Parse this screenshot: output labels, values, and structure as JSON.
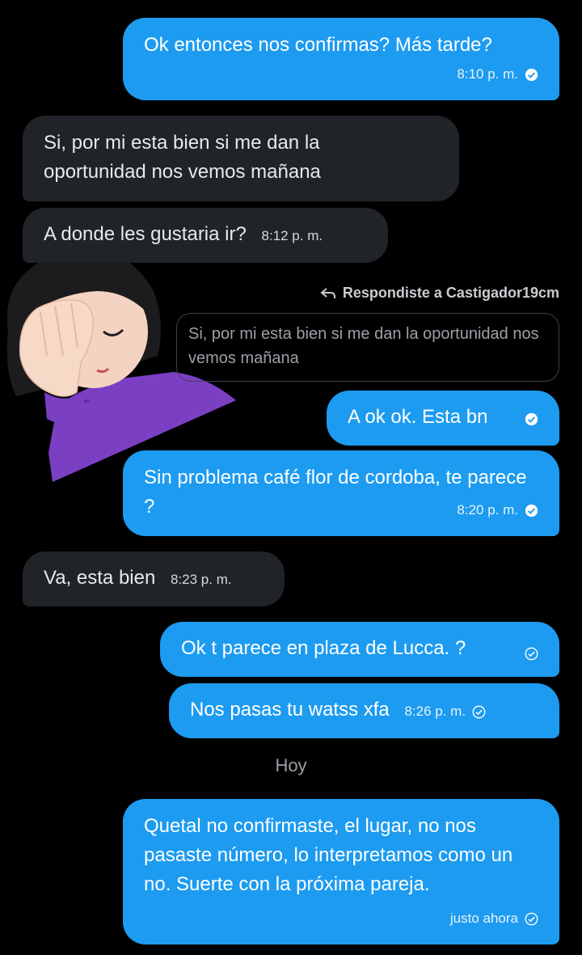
{
  "messages": [
    {
      "id": "m1",
      "text": "Ok entonces nos confirmas? Más tarde?",
      "time": "8:10 p. m."
    },
    {
      "id": "m2",
      "text": "Si, por mi esta bien si me dan la oportunidad nos vemos mañana"
    },
    {
      "id": "m3",
      "text": "A donde les gustaria ir?",
      "time": "8:12 p. m."
    },
    {
      "id": "m4",
      "text": "A ok ok. Esta bn"
    },
    {
      "id": "m5",
      "text": "Sin problema café flor de cordoba, te parece ?",
      "time": "8:20 p. m."
    },
    {
      "id": "m6",
      "text": "Va, esta bien",
      "time": "8:23 p. m."
    },
    {
      "id": "m7",
      "text": "Ok t parece en plaza de Lucca. ?"
    },
    {
      "id": "m8",
      "text": "Nos pasas tu watss xfa",
      "time": "8:26 p. m."
    },
    {
      "id": "m9",
      "text": "Quetal no confirmaste, el lugar, no nos pasaste número, lo interpretamos como un no. Suerte con la próxima pareja.",
      "time": "justo ahora"
    }
  ],
  "reply": {
    "label": "Respondiste a Castigador19cm",
    "quoted_text": "Si, por mi esta bien si me dan la oportunidad nos vemos mañana"
  },
  "date_separator": "Hoy",
  "colors": {
    "background": "#000000",
    "outgoing_bubble": "#1d9bf0",
    "incoming_bubble": "#202327",
    "text": "#e7e9ea"
  },
  "icons": {
    "read_receipt": "check-circle-icon",
    "reply": "reply-arrow-icon",
    "sticker": "facepalm-girl-sticker"
  }
}
